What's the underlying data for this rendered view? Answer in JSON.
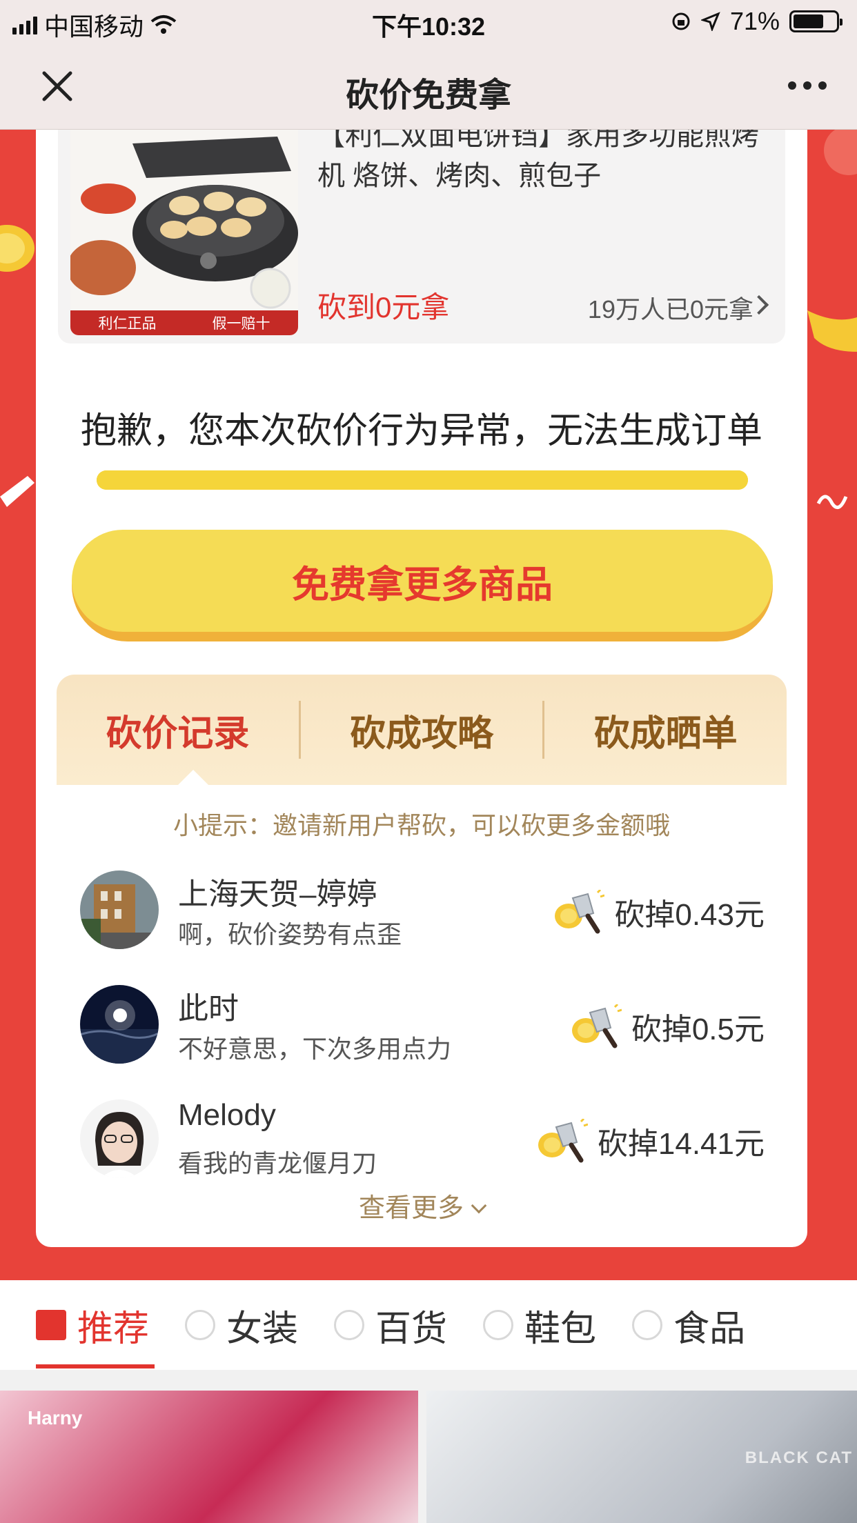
{
  "status_bar": {
    "carrier": "中国移动",
    "time": "下午10:32",
    "battery_percent": "71%",
    "battery_level": 0.71
  },
  "nav": {
    "title": "砍价免费拿"
  },
  "product": {
    "title": "【利仁双面电饼铛】家用多功能煎烤机 烙饼、烤肉、煎包子",
    "image_band_left": "利仁正品",
    "image_band_right": "假一赔十",
    "price_label": "砍到0元拿",
    "count_label": "19万人已0元拿"
  },
  "notice": "抱歉，您本次砍价行为异常，无法生成订单",
  "cta_label": "免费拿更多商品",
  "tabs": [
    "砍价记录",
    "砍成攻略",
    "砍成晒单"
  ],
  "tip": "小提示：邀请新用户帮砍，可以砍更多金额哦",
  "records": [
    {
      "name": "上海天贺–婷婷",
      "message": "啊，砍价姿势有点歪",
      "amount": "砍掉0.43元"
    },
    {
      "name": "此时",
      "message": "不好意思，下次多用点力",
      "amount": "砍掉0.5元"
    },
    {
      "name": "Melody",
      "message": "看我的青龙偃月刀",
      "amount": "砍掉14.41元"
    }
  ],
  "more_label": "查看更多",
  "categories": [
    "推荐",
    "女装",
    "百货",
    "鞋包",
    "食品"
  ],
  "banner_text": "Harny",
  "watermark": "BLACK CAT",
  "colors": {
    "brand_red": "#e2342e",
    "cta_yellow": "#f5dc55",
    "tab_bg": "#f8e4c2"
  }
}
